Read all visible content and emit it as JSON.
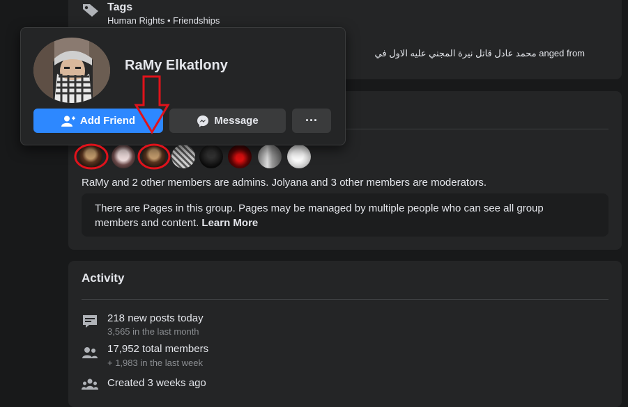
{
  "tags": {
    "title": "Tags",
    "list": "Human Rights • Friendships",
    "description": "محمد عادل قاتل نيرة المجني عليه الاول في anged from"
  },
  "profile_popup": {
    "name": "RaMy Elkatlony",
    "add_friend_label": "Add Friend",
    "message_label": "Message",
    "more_label": "···"
  },
  "admins": {
    "summary": "RaMy and 2 other members are admins. Jolyana and 3 other members are moderators.",
    "pages_notice": "There are Pages in this group. Pages may be managed by multiple people who can see all group members and content.",
    "learn_more": "Learn More"
  },
  "activity": {
    "title": "Activity",
    "items": [
      {
        "icon": "posts-icon",
        "main": "218 new posts today",
        "sub": "3,565 in the last month"
      },
      {
        "icon": "members-icon",
        "main": "17,952 total members",
        "sub": "+ 1,983 in the last week"
      },
      {
        "icon": "group-created-icon",
        "main": "Created 3 weeks ago",
        "sub": ""
      }
    ]
  },
  "colors": {
    "background": "#18191a",
    "card": "#242526",
    "primary_button": "#2d88ff",
    "annotation": "#e0121b"
  }
}
